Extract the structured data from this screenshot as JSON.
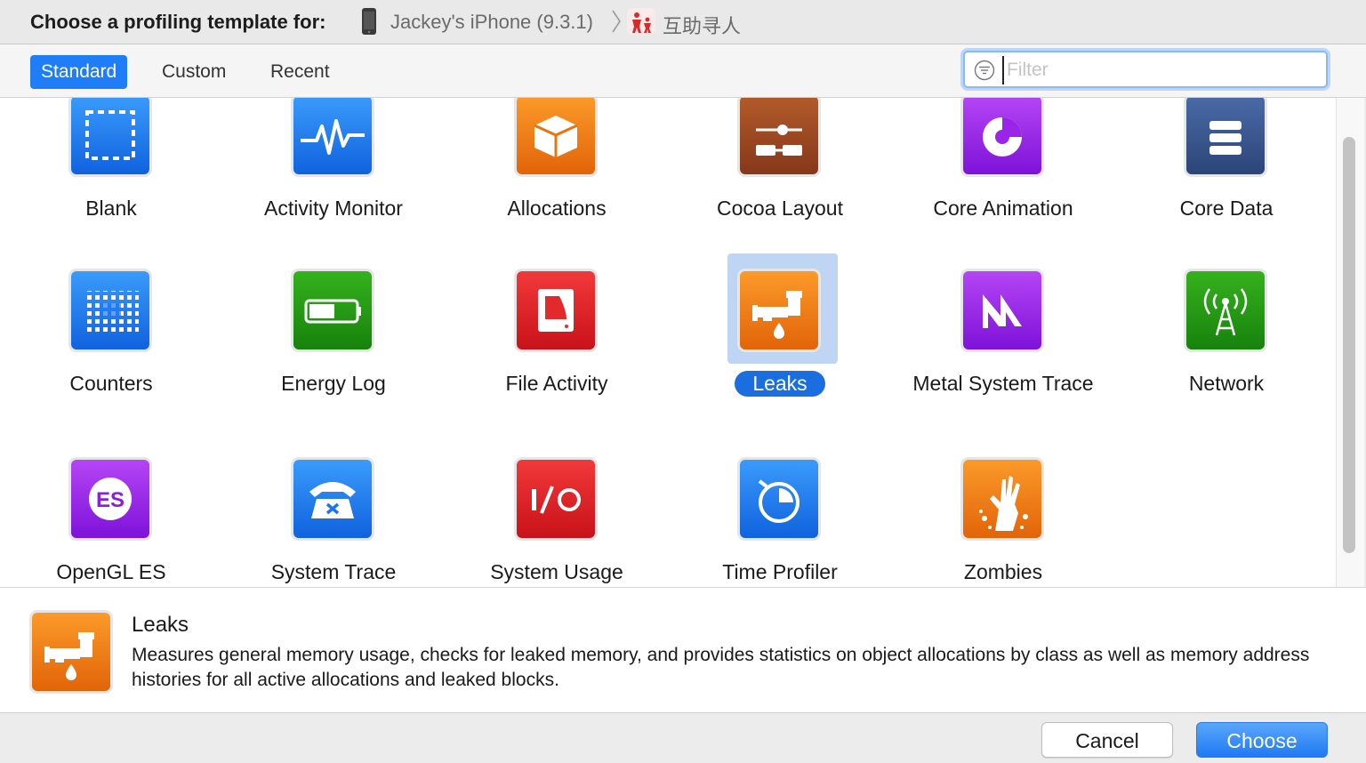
{
  "header": {
    "title": "Choose a profiling template for:",
    "device_name": "Jackey's iPhone (9.3.1)",
    "app_name": "互助寻人"
  },
  "toolbar": {
    "tabs": [
      {
        "label": "Standard",
        "active": true
      },
      {
        "label": "Custom",
        "active": false
      },
      {
        "label": "Recent",
        "active": false
      }
    ],
    "filter": {
      "placeholder": "Filter",
      "value": ""
    }
  },
  "templates": [
    {
      "label": "Blank",
      "icon": "blank-icon",
      "selected": false
    },
    {
      "label": "Activity Monitor",
      "icon": "activity-monitor-icon",
      "selected": false
    },
    {
      "label": "Allocations",
      "icon": "allocations-icon",
      "selected": false
    },
    {
      "label": "Cocoa Layout",
      "icon": "cocoa-layout-icon",
      "selected": false
    },
    {
      "label": "Core Animation",
      "icon": "core-animation-icon",
      "selected": false
    },
    {
      "label": "Core Data",
      "icon": "core-data-icon",
      "selected": false
    },
    {
      "label": "Counters",
      "icon": "counters-icon",
      "selected": false
    },
    {
      "label": "Energy Log",
      "icon": "energy-log-icon",
      "selected": false
    },
    {
      "label": "File Activity",
      "icon": "file-activity-icon",
      "selected": false
    },
    {
      "label": "Leaks",
      "icon": "leaks-icon",
      "selected": true
    },
    {
      "label": "Metal System Trace",
      "icon": "metal-system-trace-icon",
      "selected": false
    },
    {
      "label": "Network",
      "icon": "network-icon",
      "selected": false
    },
    {
      "label": "OpenGL ES",
      "icon": "opengl-es-icon",
      "selected": false
    },
    {
      "label": "System Trace",
      "icon": "system-trace-icon",
      "selected": false
    },
    {
      "label": "System Usage",
      "icon": "system-usage-icon",
      "selected": false
    },
    {
      "label": "Time Profiler",
      "icon": "time-profiler-icon",
      "selected": false
    },
    {
      "label": "Zombies",
      "icon": "zombies-icon",
      "selected": false
    }
  ],
  "detail": {
    "title": "Leaks",
    "description": "Measures general memory usage, checks for leaked memory, and provides statistics on object allocations by class as well as memory address histories for all active allocations and leaked blocks."
  },
  "footer": {
    "cancel_label": "Cancel",
    "choose_label": "Choose"
  },
  "colors": {
    "accent": "#1f7ef7",
    "selection": "#bed6f3"
  }
}
